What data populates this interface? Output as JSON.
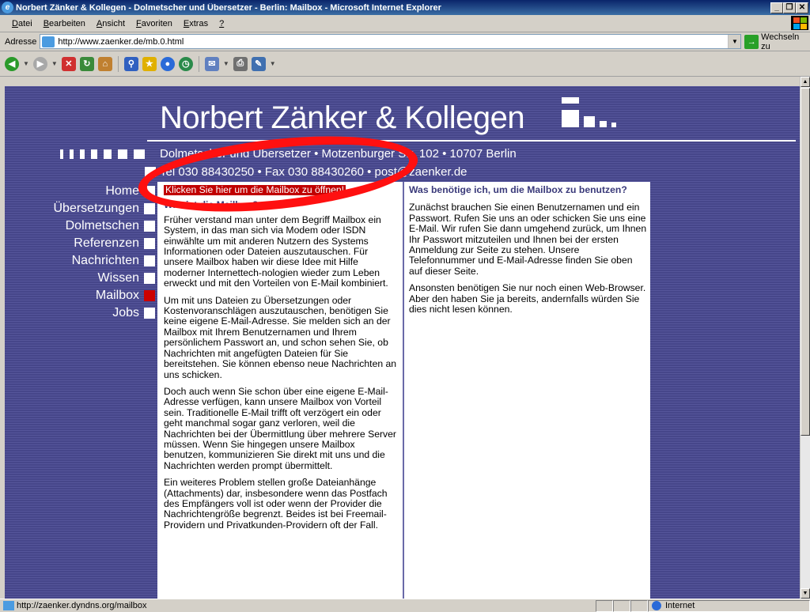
{
  "window": {
    "title": "Norbert Zänker & Kollegen - Dolmetscher und Übersetzer - Berlin: Mailbox - Microsoft Internet Explorer",
    "buttons": [
      "_",
      "❐",
      "✕"
    ]
  },
  "menu": {
    "items": [
      {
        "underline": "D",
        "rest": "atei"
      },
      {
        "underline": "B",
        "rest": "earbeiten"
      },
      {
        "underline": "A",
        "rest": "nsicht"
      },
      {
        "underline": "F",
        "rest": "avoriten"
      },
      {
        "underline": "E",
        "rest": "xtras"
      },
      {
        "underline": "?",
        "rest": ""
      }
    ]
  },
  "address": {
    "label": "Adresse",
    "url": "http://www.zaenker.de/mb.0.html",
    "go_label": "Wechseln zu"
  },
  "toolbar": {
    "icons": [
      "back-icon",
      "forward-icon",
      "stop-icon",
      "refresh-icon",
      "home-icon",
      "search-icon",
      "favorites-icon",
      "media-icon",
      "history-icon",
      "mail-icon",
      "print-icon",
      "edit-icon"
    ]
  },
  "site": {
    "logo": "Norbert Zänker & Kollegen",
    "address_line": "Dolmetscher und Übersetzer • Motzenburger Str. 102 • 10707 Berlin",
    "tel_line": "Tel 030 88430250 • Fax 030 88430260 • post@zaenker.de"
  },
  "nav": {
    "items": [
      {
        "label": "Home",
        "active": false
      },
      {
        "label": "Übersetzungen",
        "active": false
      },
      {
        "label": "Dolmetschen",
        "active": false
      },
      {
        "label": "Referenzen",
        "active": false
      },
      {
        "label": "Nachrichten",
        "active": false
      },
      {
        "label": "Wissen",
        "active": false
      },
      {
        "label": "Mailbox",
        "active": true
      },
      {
        "label": "Jobs",
        "active": false
      }
    ]
  },
  "content": {
    "mailbox_link": "Klicken Sie hier um die Mailbox zu öffnen!",
    "col1_heading": "Was ist die Mailbox?",
    "col1_paragraphs": [
      "Früher verstand man unter dem Begriff Mailbox ein System, in das man sich via Modem oder ISDN einwählte um mit anderen Nutzern des Systems Informationen oder Dateien auszutauschen. Für unsere Mailbox haben wir diese Idee mit Hilfe moderner Internettech-nologien wieder zum Leben erweckt und mit den Vorteilen von E-Mail kombiniert.",
      "Um mit uns Dateien zu Übersetzungen oder Kostenvoranschlägen auszutauschen, benötigen Sie keine eigene E-Mail-Adresse. Sie melden sich an der Mailbox mit Ihrem Benutzernamen und Ihrem persönlichem Passwort an, und schon sehen Sie, ob Nachrichten mit angefügten Dateien für Sie bereitstehen. Sie können ebenso neue Nachrichten an uns schicken.",
      "Doch auch wenn Sie schon über eine eigene E-Mail-Adresse verfügen, kann unsere Mailbox von Vorteil sein. Traditionelle E-Mail trifft oft verzögert ein oder geht manchmal sogar ganz verloren, weil die Nachrichten bei der Übermittlung über mehrere Server müssen. Wenn Sie hingegen unsere Mailbox benutzen, kommunizieren Sie direkt mit uns und die Nachrichten werden prompt übermittelt.",
      "Ein weiteres Problem stellen große Dateianhänge (Attachments) dar, insbesondere wenn das Postfach des Empfängers voll ist oder wenn der Provider die Nachrichtengröße begrenzt. Beides ist bei Freemail-Providern und Privatkunden-Providern oft der Fall."
    ],
    "col2_heading": "Was benötige ich, um die Mailbox zu benutzen?",
    "col2_paragraphs": [
      "Zunächst brauchen Sie einen Benutzernamen und ein Passwort. Rufen Sie uns an oder schicken Sie uns eine E-Mail. Wir rufen Sie dann umgehend zurück, um Ihnen Ihr Passwort mitzuteilen und Ihnen bei der ersten Anmeldung zur Seite zu stehen. Unsere Telefonnummer und E-Mail-Adresse finden Sie oben auf dieser Seite.",
      "Ansonsten benötigen Sie nur noch einen Web-Browser. Aber den haben Sie ja bereits, andernfalls würden Sie dies nicht lesen können."
    ]
  },
  "status": {
    "text": "http://zaenker.dyndns.org/mailbox",
    "zone": "Internet"
  }
}
